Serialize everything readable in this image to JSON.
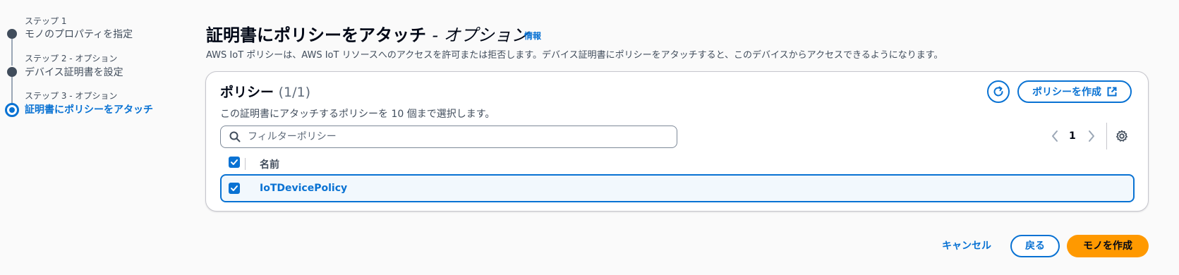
{
  "stepper": {
    "steps": [
      {
        "sub": "ステップ 1",
        "title": "モノのプロパティを指定"
      },
      {
        "sub": "ステップ 2 - オプション",
        "title": "デバイス証明書を設定"
      },
      {
        "sub": "ステップ 3 - オプション",
        "title": "証明書にポリシーをアタッチ"
      }
    ]
  },
  "header": {
    "title": "証明書にポリシーをアタッチ",
    "title_optional": "- オプション",
    "info_link": "情報",
    "description": "AWS IoT ポリシーは、AWS IoT リソースへのアクセスを許可または拒否します。デバイス証明書にポリシーをアタッチすると、このデバイスからアクセスできるようになります。"
  },
  "policies": {
    "title": "ポリシー",
    "count": "(1/1)",
    "description": "この証明書にアタッチするポリシーを 10 個まで選択します。",
    "create_button": "ポリシーを作成",
    "search_placeholder": "フィルターポリシー",
    "page_number": "1",
    "column_header": "名前",
    "rows": [
      {
        "name": "IoTDevicePolicy",
        "selected": true
      }
    ]
  },
  "footer": {
    "cancel": "キャンセル",
    "back": "戻る",
    "create_thing": "モノを作成"
  },
  "colors": {
    "accent": "#0972d3",
    "primary_button": "#ff9900",
    "step_inactive": "#414d5c"
  },
  "icons": {
    "refresh": "refresh-icon",
    "external": "external-link-icon",
    "search": "search-icon",
    "prev": "chevron-left-icon",
    "next": "chevron-right-icon",
    "settings": "gear-icon",
    "check": "check-icon"
  }
}
